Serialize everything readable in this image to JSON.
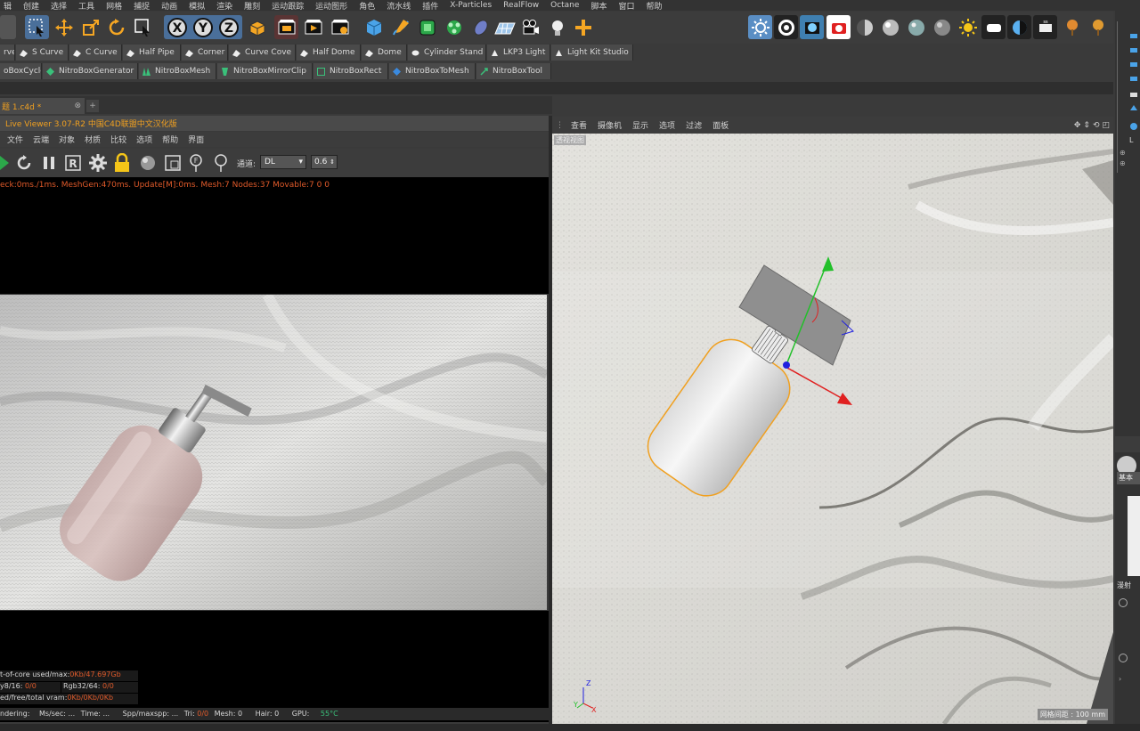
{
  "menu": [
    "辑",
    "创建",
    "选择",
    "工具",
    "网格",
    "捕捉",
    "动画",
    "模拟",
    "渲染",
    "雕刻",
    "运动跟踪",
    "运动图形",
    "角色",
    "流水线",
    "插件",
    "X-Particles",
    "RealFlow",
    "Octane",
    "脚本",
    "窗口",
    "帮助"
  ],
  "plugins": [
    "rve",
    "S Curve",
    "C Curve",
    "Half Pipe",
    "Corner",
    "Curve Cove",
    "Half Dome",
    "Dome",
    "Cylinder Stand",
    "LKP3 Light",
    "Light Kit Studio"
  ],
  "nitro": [
    "oBoxCycle",
    "NitroBoxGenerator",
    "NitroBoxMesh",
    "NitroBoxMirrorClip",
    "NitroBoxRect",
    "NitroBoxToMesh",
    "NitroBoxTool"
  ],
  "document": {
    "tab": "题 1.c4d *"
  },
  "live_viewer": {
    "title": "Live Viewer 3.07-R2 中国C4D联盟中文汉化版",
    "menu": [
      "文件",
      "云端",
      "对象",
      "材质",
      "比较",
      "选项",
      "帮助",
      "界面"
    ],
    "channel_label": "通道:",
    "channel_value": "DL",
    "channel_number": "0.6",
    "stats": "eck:0ms./1ms. MeshGen:470ms. Update[M]:0ms. Mesh:7 Nodes:37 Movable:7  0 0",
    "info": {
      "core_label": "t-of-core used/max:",
      "core_value": "0Kb/47.697Gb",
      "rgb8_label": "y8/16:",
      "rgb8_value": "0/0",
      "rgb32_label": "Rgb32/64:",
      "rgb32_value": "0/0",
      "vram_label": "ed/free/total vram:",
      "vram_value": "0Kb/0Kb/0Kb"
    },
    "status": {
      "rendering": "ndering:",
      "ms_sec": "Ms/sec: ...",
      "time": "Time: ...",
      "spp": "Spp/maxspp: ...",
      "tri": "Tri:",
      "tri_value": "0/0",
      "mesh": "Mesh:",
      "mesh_value": "0",
      "hair": "Hair:",
      "hair_value": "0",
      "gpu": "GPU:",
      "gpu_value": "55°C"
    }
  },
  "viewport": {
    "menu": [
      "查看",
      "摄像机",
      "显示",
      "选项",
      "过滤",
      "面板"
    ],
    "label": "透视视图",
    "grid_spacing": "网格间距 : 100 mm"
  },
  "right_panel": {
    "tab_label": "基本",
    "section_label": "漫射"
  },
  "colors": {
    "accent_orange": "#f0a020",
    "stats_orange": "#e05a2a",
    "highlight_blue": "#4a6f9a",
    "axis_green": "#22c02a",
    "axis_red": "#e02020",
    "axis_blue": "#2020e0"
  }
}
